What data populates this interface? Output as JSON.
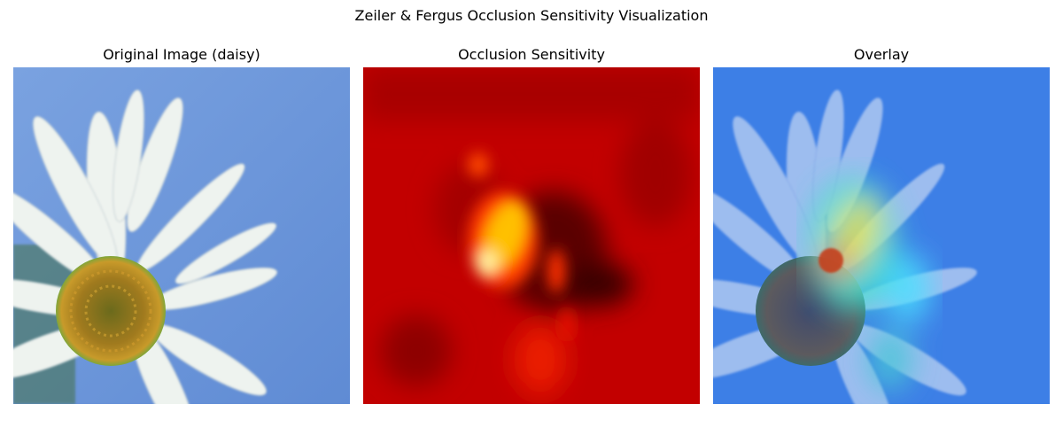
{
  "figure": {
    "title": "Zeiler & Fergus Occlusion Sensitivity Visualization"
  },
  "panels": [
    {
      "title": "Original Image (daisy)"
    },
    {
      "title": "Occlusion Sensitivity"
    },
    {
      "title": "Overlay"
    }
  ],
  "colors": {
    "sky": "#6f98da",
    "petal": "#eef3ef",
    "flower_center": "#9c7a22",
    "heat_low": "#c40000",
    "heat_mid": "#ff4a00",
    "heat_high": "#fff3a0",
    "overlay_base": "#3d7fe6"
  }
}
